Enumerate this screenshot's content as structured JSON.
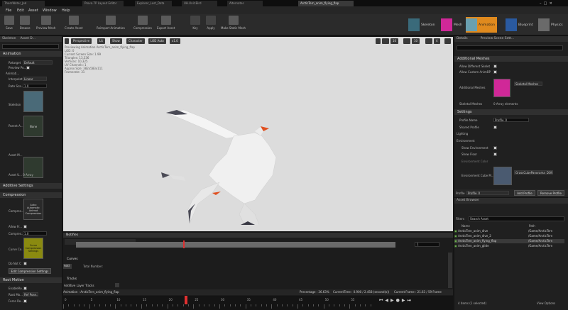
{
  "tabs": [
    "ThemWater_Jed",
    "Prova.7P Layout Editor",
    "Explorer_Lost_Data",
    "UH.Unit.Bird",
    "Alternates",
    "ArcticTern_anim_flying_flap"
  ],
  "menu": [
    "File",
    "Edit",
    "Asset",
    "Window",
    "Help"
  ],
  "toolbar": [
    "Save",
    "Browse",
    "Preview Mesh",
    "Create Asset",
    "Reimport Animation",
    "Compression",
    "Export Asset",
    "Key",
    "Apply",
    "Make Static Mesh"
  ],
  "modes": [
    "Skeleton",
    "Mesh",
    "Animation",
    "Blueprint",
    "Physics"
  ],
  "left": {
    "tabs": [
      "Skeleton",
      "Asset D..."
    ],
    "animation": "Animation",
    "retarget_label": "Retarget",
    "retarget_value": "Default",
    "preview_label": "Preview Po...",
    "animation_sub": "Animati...",
    "interp_label": "Interpolat...",
    "interp_value": "Linear",
    "rate_label": "Rate Sca...",
    "rate_value": "1.0",
    "skeleton_label": "Skeleton",
    "parent_label": "Parent A...",
    "parent_value": "None",
    "asset_m_label": "Asset M...",
    "asset_u_label": "Asset U... 0 Array",
    "additive": "Additive Settings",
    "compression": "Compression",
    "compress_label": "Compres...",
    "compress_value": "Auto: Automatic Animat Compression",
    "allow_fr": "Allow Fr...",
    "compress_co": "Compres...",
    "compress_co_value": "1.0",
    "curve_co": "Curve Co...",
    "curve_co_value": "Curve Compression Settings",
    "do_not": "Do Not C",
    "edit_btn": "Edit Compression Settings",
    "root_motion": "Root Motion",
    "enable_root": "EnableRo...",
    "root_mo": "Root Mo...",
    "root_mo_value": "Ref Pose...",
    "force_ro": "Force Ro..."
  },
  "viewport": {
    "buttons": [
      "Perspective",
      "Lit",
      "Show",
      "Character",
      "LOD Auto",
      "x1.0"
    ],
    "info": [
      "Previewing Animation ArcticTern_anim_flying_flap",
      "LOD: 0",
      "Current Screen Size: 1.99",
      "Triangles: 13,336",
      "Vertices: 10,325",
      "UV Channels: 1",
      "Approx Size: 382x583x111",
      "Framerate: 31"
    ]
  },
  "notifies": {
    "header": "Notifies",
    "num": "1",
    "curves": "Curves",
    "add": "Add",
    "total": "Total Number:",
    "tracks": "Tracks",
    "additive_tracks": "Additive Layer Tracks"
  },
  "status": {
    "animation": "Animation : ArcticTern_anim_flying_flap",
    "percentage": "Percentage : 36.63%",
    "current_time": "CurrentTime : 0.900 / 2.458 (second(s))",
    "current_frame": "Current Frame : 21.63 / 59 Frame"
  },
  "timeline": {
    "numbers": [
      "0",
      "5",
      "10",
      "15",
      "20",
      "25",
      "30",
      "35",
      "40",
      "45",
      "50",
      "55"
    ]
  },
  "details": {
    "tabs": [
      "Details",
      "Preview Scene Sett..."
    ],
    "search": "Search",
    "add_meshes": "Additional Meshes",
    "allow_diff": "Allow Different Skelet",
    "allow_custom": "Allow Custom AnimBP",
    "additional_meshes": "Additional Meshes",
    "mesh_value": "Skeletal Meshes",
    "skeletal_meshes": "Skeletal Meshes",
    "skeletal_meshes_value": "0 Array elements",
    "settings": "Settings",
    "profile_name": "Profile Name",
    "profile_name_value": "Profile_0",
    "shared_profile": "Shared Profile",
    "lighting": "Lighting",
    "environment": "Environment",
    "show_env": "Show Environment",
    "show_floor": "Show Floor",
    "env_color": "Environment Color",
    "env_cube": "Environment Cube M...",
    "env_cube_value": "GrassCubePanorama_DOW",
    "profile_label": "Profile",
    "profile_value": "Profile_0",
    "add_profile": "Add Profile",
    "remove_profile": "Remove Profile"
  },
  "asset_browser": {
    "tab": "Asset Browser",
    "filters": "Filters",
    "search": "Search Asset",
    "col_name": "Name",
    "col_path": "Path",
    "items": [
      {
        "name": "ArcticTern_anim_dive",
        "path": "/Game/ArcticTern"
      },
      {
        "name": "ArcticTern_anim_dive_2",
        "path": "/Game/ArcticTern"
      },
      {
        "name": "ArcticTern_anim_flying_flap",
        "path": "/Game/ArcticTern"
      },
      {
        "name": "ArcticTern_anim_glide",
        "path": "/Game/ArcticTern"
      }
    ],
    "count": "4 items (1 selected)",
    "view_options": "View Options"
  },
  "colors": {
    "accent": "#e08a1e",
    "selected_tab": "#3a3a3a",
    "viewport_bg": "#dcdcdc"
  }
}
